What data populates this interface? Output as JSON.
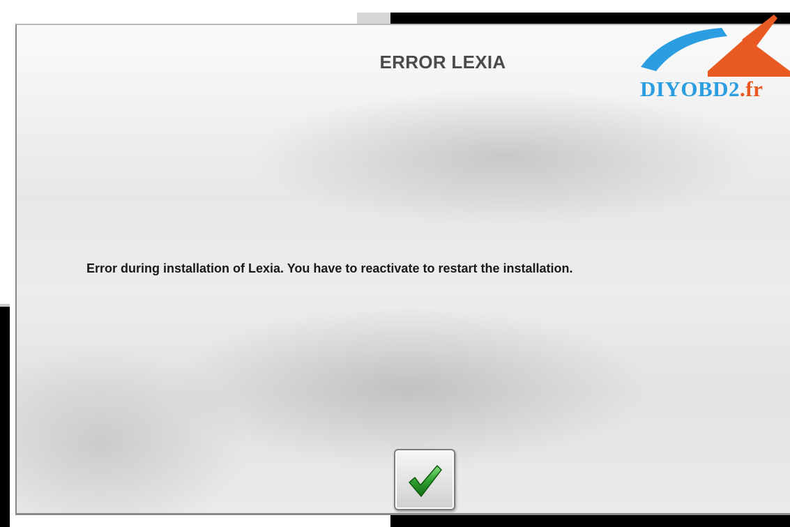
{
  "dialog": {
    "title": "ERROR LEXIA",
    "message": "Error during installation of Lexia. You have to reactivate to restart the installation.",
    "ok_icon": "checkmark-icon"
  },
  "watermark": {
    "text_main": "DIYOBD2",
    "text_suffix": ".fr",
    "colors": {
      "blue": "#2a9ee0",
      "orange": "#e85a22"
    }
  },
  "colors": {
    "title": "#4a4a4a",
    "message": "#1a1a1a",
    "check": "#2fa02f"
  }
}
